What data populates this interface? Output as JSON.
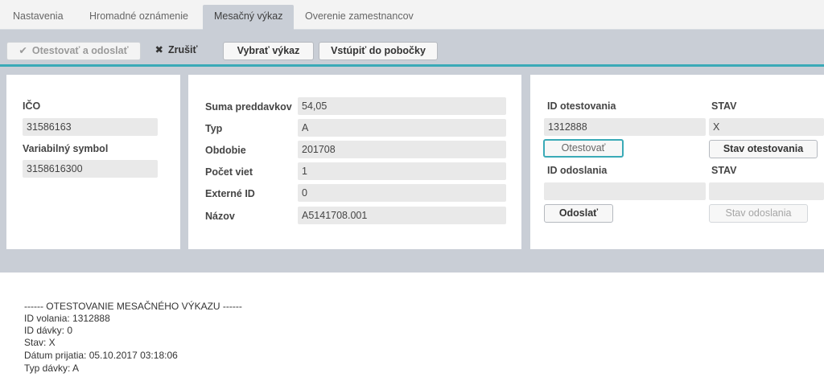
{
  "tabs": [
    {
      "label": "Nastavenia"
    },
    {
      "label": "Hromadné oznámenie"
    },
    {
      "label": "Mesačný výkaz",
      "active": true
    },
    {
      "label": "Overenie zamestnancov"
    }
  ],
  "toolbar": {
    "attest_send_label": "Otestovať a odoslať",
    "cancel_label": "Zrušiť",
    "select_report_label": "Vybrať výkaz",
    "enter_branch_label": "Vstúpiť do pobočky"
  },
  "employer": {
    "ico_label": "IČO",
    "ico_value": "31586163",
    "varsym_label": "Variabilný symbol",
    "varsym_value": "3158616300"
  },
  "report": {
    "rows": [
      {
        "label": "Suma preddavkov",
        "value": "54,05"
      },
      {
        "label": "Typ",
        "value": "A"
      },
      {
        "label": "Obdobie",
        "value": "201708"
      },
      {
        "label": "Počet viet",
        "value": "1"
      },
      {
        "label": "Externé ID",
        "value": "0"
      },
      {
        "label": "Názov",
        "value": "A5141708.001"
      }
    ]
  },
  "status": {
    "test_id_label": "ID otestovania",
    "test_id_value": "1312888",
    "test_state_label": "STAV",
    "test_state_value": "X",
    "test_button": "Otestovať",
    "test_state_button": "Stav otestovania",
    "send_id_label": "ID odoslania",
    "send_id_value": "",
    "send_state_label": "STAV",
    "send_state_value": "",
    "send_button": "Odoslať",
    "send_state_button": "Stav odoslania"
  },
  "log": {
    "lines": [
      "------ OTESTOVANIE MESAČNÉHO VÝKAZU ------",
      "ID volania: 1312888",
      "ID dávky: 0",
      "Stav: X",
      "Dátum prijatia: 05.10.2017 03:18:06",
      "Typ dávky: A"
    ]
  },
  "colors": {
    "accent": "#3aaab7",
    "background": "#c9ced6",
    "field": "#e9e9e9"
  }
}
